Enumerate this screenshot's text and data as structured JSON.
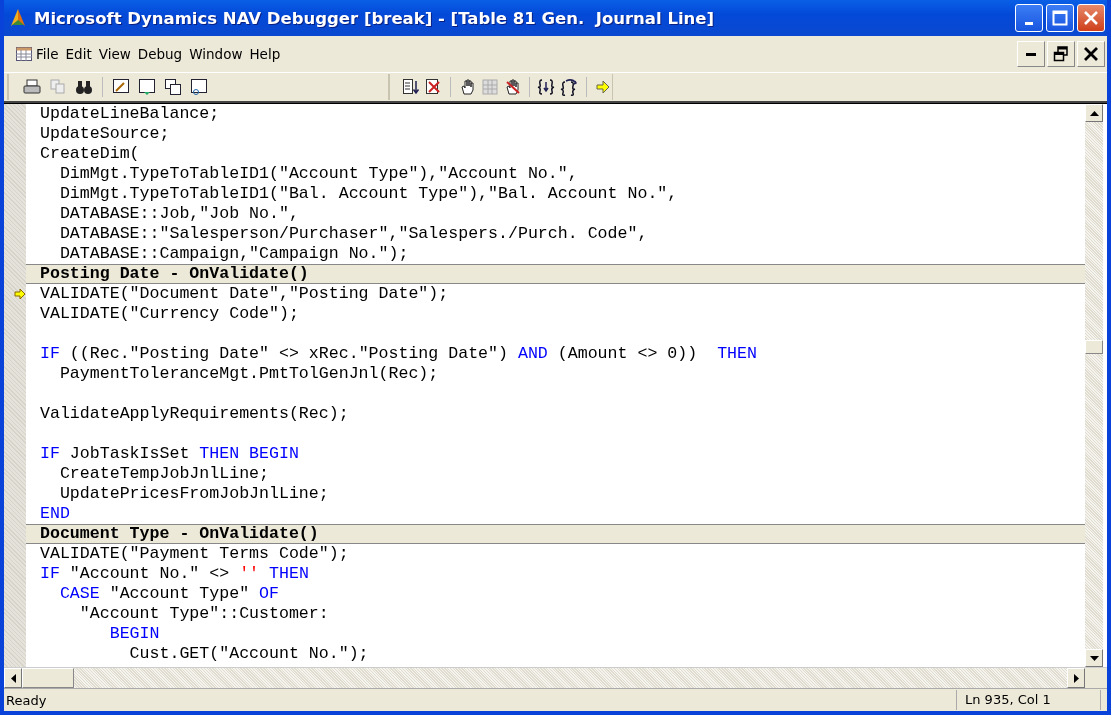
{
  "window": {
    "title": "Microsoft Dynamics NAV Debugger [break] - [Table 81 Gen.  Journal Line]"
  },
  "menu": [
    {
      "label": "File"
    },
    {
      "label": "Edit"
    },
    {
      "label": "View"
    },
    {
      "label": "Debug"
    },
    {
      "label": "Window"
    },
    {
      "label": "Help"
    }
  ],
  "code_lines": [
    {
      "kind": "code",
      "current": false,
      "tokens": [
        {
          "kind": "text",
          "text": "UpdateLineBalance;"
        }
      ]
    },
    {
      "kind": "code",
      "current": false,
      "tokens": [
        {
          "kind": "text",
          "text": "UpdateSource;"
        }
      ]
    },
    {
      "kind": "code",
      "current": false,
      "tokens": [
        {
          "kind": "text",
          "text": "CreateDim("
        }
      ]
    },
    {
      "kind": "code",
      "current": false,
      "tokens": [
        {
          "kind": "text",
          "text": "  DimMgt.TypeToTableID1(\"Account Type\"),\"Account No.\","
        }
      ]
    },
    {
      "kind": "code",
      "current": false,
      "tokens": [
        {
          "kind": "text",
          "text": "  DimMgt.TypeToTableID1(\"Bal. Account Type\"),\"Bal. Account No.\","
        }
      ]
    },
    {
      "kind": "code",
      "current": false,
      "tokens": [
        {
          "kind": "text",
          "text": "  DATABASE::Job,\"Job No.\","
        }
      ]
    },
    {
      "kind": "code",
      "current": false,
      "tokens": [
        {
          "kind": "text",
          "text": "  DATABASE::\"Salesperson/Purchaser\",\"Salespers./Purch. Code\","
        }
      ]
    },
    {
      "kind": "code",
      "current": false,
      "tokens": [
        {
          "kind": "text",
          "text": "  DATABASE::Campaign,\"Campaign No.\");"
        }
      ]
    },
    {
      "kind": "header",
      "current": false,
      "tokens": [
        {
          "kind": "text",
          "text": "Posting Date - OnValidate()"
        }
      ]
    },
    {
      "kind": "code",
      "current": true,
      "tokens": [
        {
          "kind": "text",
          "text": "VALIDATE(\"Document Date\",\"Posting Date\");"
        }
      ]
    },
    {
      "kind": "code",
      "current": false,
      "tokens": [
        {
          "kind": "text",
          "text": "VALIDATE(\"Currency Code\");"
        }
      ]
    },
    {
      "kind": "blank"
    },
    {
      "kind": "code",
      "current": false,
      "tokens": [
        {
          "kind": "keyword",
          "text": "IF"
        },
        {
          "kind": "text",
          "text": " ((Rec.\"Posting Date\" <> xRec.\"Posting Date\") "
        },
        {
          "kind": "keyword",
          "text": "AND"
        },
        {
          "kind": "text",
          "text": " (Amount <> 0))  "
        },
        {
          "kind": "keyword",
          "text": "THEN"
        }
      ]
    },
    {
      "kind": "code",
      "current": false,
      "tokens": [
        {
          "kind": "text",
          "text": "  PaymentToleranceMgt.PmtTolGenJnl(Rec);"
        }
      ]
    },
    {
      "kind": "blank"
    },
    {
      "kind": "code",
      "current": false,
      "tokens": [
        {
          "kind": "text",
          "text": "ValidateApplyRequirements(Rec);"
        }
      ]
    },
    {
      "kind": "blank"
    },
    {
      "kind": "code",
      "current": false,
      "tokens": [
        {
          "kind": "keyword",
          "text": "IF"
        },
        {
          "kind": "text",
          "text": " JobTaskIsSet "
        },
        {
          "kind": "keyword",
          "text": "THEN BEGIN"
        }
      ]
    },
    {
      "kind": "code",
      "current": false,
      "tokens": [
        {
          "kind": "text",
          "text": "  CreateTempJobJnlLine;"
        }
      ]
    },
    {
      "kind": "code",
      "current": false,
      "tokens": [
        {
          "kind": "text",
          "text": "  UpdatePricesFromJobJnlLine;"
        }
      ]
    },
    {
      "kind": "code",
      "current": false,
      "tokens": [
        {
          "kind": "keyword",
          "text": "END"
        }
      ]
    },
    {
      "kind": "header",
      "current": false,
      "tokens": [
        {
          "kind": "text",
          "text": "Document Type - OnValidate()"
        }
      ]
    },
    {
      "kind": "code",
      "current": false,
      "tokens": [
        {
          "kind": "text",
          "text": "VALIDATE(\"Payment Terms Code\");"
        }
      ]
    },
    {
      "kind": "code",
      "current": false,
      "tokens": [
        {
          "kind": "keyword",
          "text": "IF"
        },
        {
          "kind": "text",
          "text": " \"Account No.\" <> "
        },
        {
          "kind": "string",
          "text": "''"
        },
        {
          "kind": "keyword",
          "text": " THEN"
        }
      ]
    },
    {
      "kind": "code",
      "current": false,
      "tokens": [
        {
          "kind": "keyword",
          "text": "  CASE"
        },
        {
          "kind": "text",
          "text": " \"Account Type\" "
        },
        {
          "kind": "keyword",
          "text": "OF"
        }
      ]
    },
    {
      "kind": "code",
      "current": false,
      "tokens": [
        {
          "kind": "text",
          "text": "    \"Account Type\"::Customer:"
        }
      ]
    },
    {
      "kind": "code",
      "current": false,
      "tokens": [
        {
          "kind": "keyword",
          "text": "       BEGIN"
        }
      ]
    },
    {
      "kind": "code",
      "current": false,
      "tokens": [
        {
          "kind": "text",
          "text": "         Cust.GET(\"Account No.\");"
        }
      ]
    }
  ],
  "status_bar": {
    "message": "Ready",
    "position": "Ln 935, Col 1"
  }
}
